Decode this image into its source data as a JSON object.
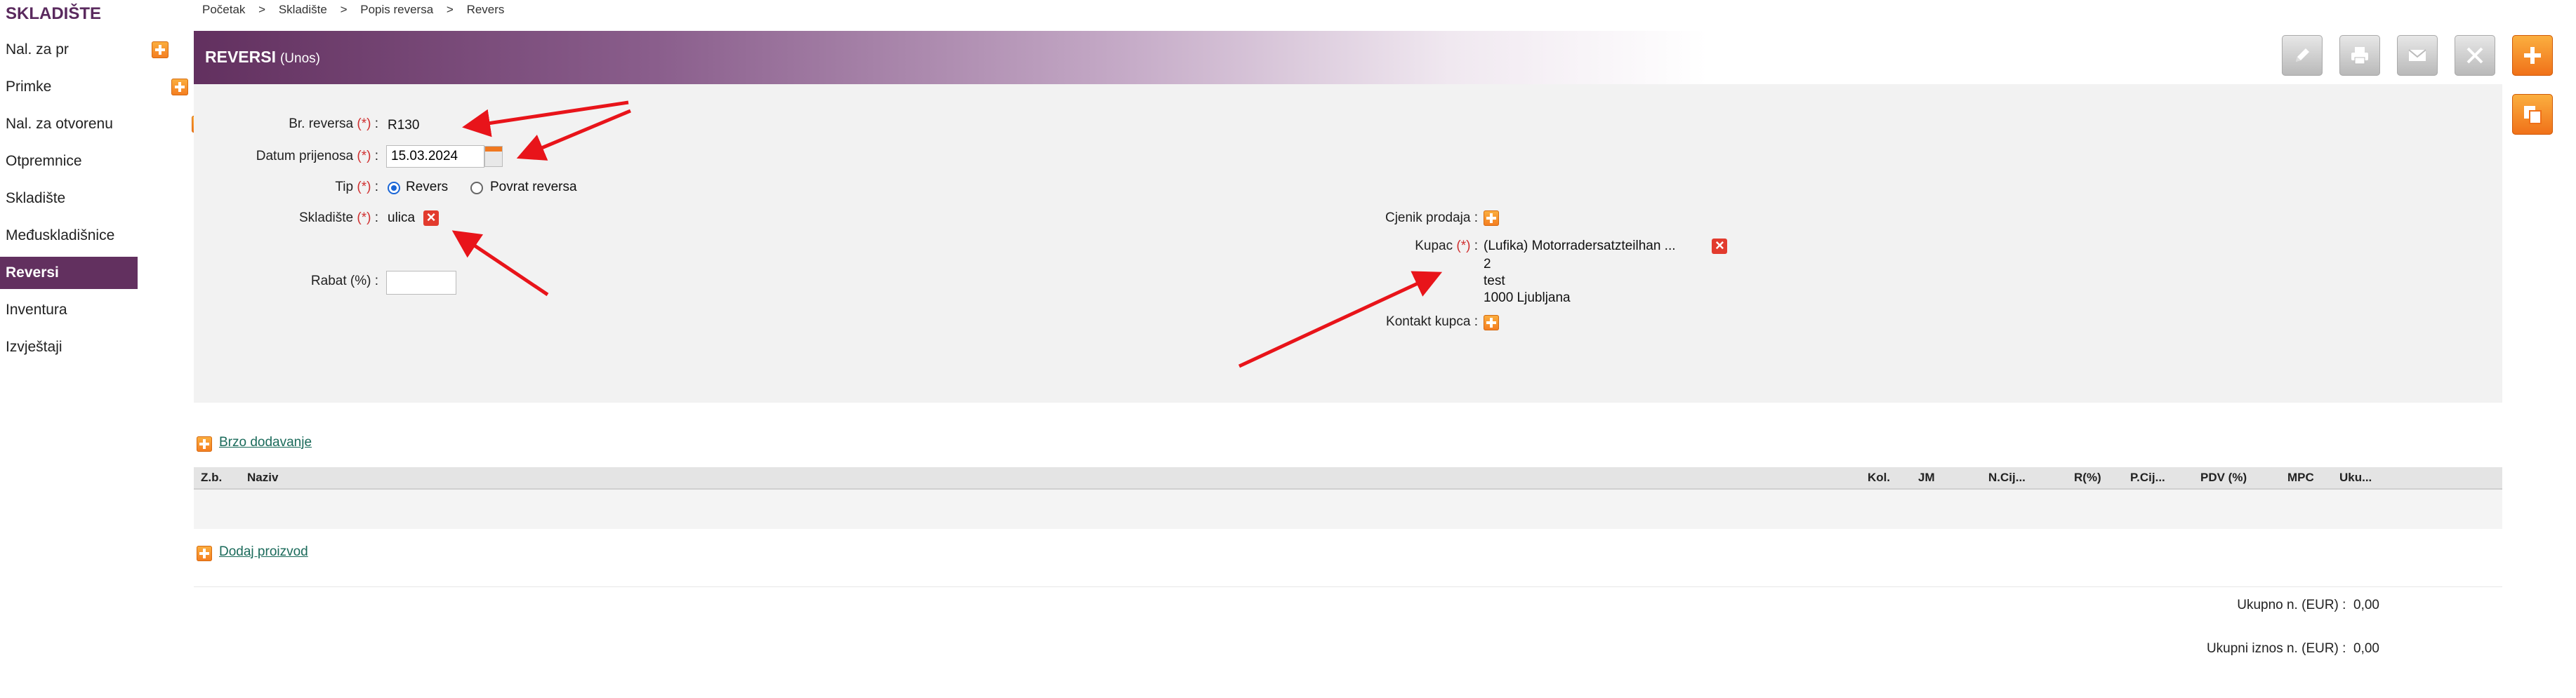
{
  "sidebar": {
    "title": "SKLADIŠTE",
    "items": [
      {
        "label": "Nal. za pr",
        "active": false
      },
      {
        "label": "Primke",
        "active": false
      },
      {
        "label": "Nal. za otvorenu",
        "active": false
      },
      {
        "label": "Otpremnice",
        "active": false
      },
      {
        "label": "Skladište",
        "active": false
      },
      {
        "label": "Međuskladišnice",
        "active": false
      },
      {
        "label": "Reversi",
        "active": true
      },
      {
        "label": "Inventura",
        "active": false
      },
      {
        "label": "Izvještaji",
        "active": false
      }
    ]
  },
  "breadcrumb": [
    "Početak",
    ">",
    "Skladište",
    ">",
    "Popis reversa",
    ">",
    "Revers"
  ],
  "header": {
    "title": "REVERSI",
    "subtitle": "(Unos)"
  },
  "toolbar": {
    "edit_icon": "pencil-icon",
    "print_icon": "printer-icon",
    "email_icon": "envelope-icon",
    "cancel_icon": "close-icon",
    "add_icon": "plus-icon",
    "copy_icon": "copy-icon"
  },
  "form": {
    "br_reversa": {
      "label": "Br. reversa",
      "required": "(*)",
      "value": "R130"
    },
    "datum": {
      "label": "Datum prijenosa",
      "required": "(*)",
      "value": "15.03.2024"
    },
    "tip": {
      "label": "Tip",
      "required": "(*)",
      "options": [
        "Revers",
        "Povrat reversa"
      ],
      "selected": "Revers"
    },
    "skladiste": {
      "label": "Skladište",
      "required": "(*)",
      "value": "ulica"
    },
    "rabat": {
      "label": "Rabat (%)",
      "value": ""
    },
    "cjenik": {
      "label": "Cjenik prodaja"
    },
    "kupac": {
      "label": "Kupac",
      "required": "(*)",
      "name": "(Lufika) Motorradersatzteilhan ...",
      "line1": "2",
      "line2": "test",
      "line3": "1000 Ljubljana"
    },
    "kontakt": {
      "label": "Kontakt kupca"
    },
    "colon": ":"
  },
  "links": {
    "quick_add": "Brzo dodavanje",
    "add_product": "Dodaj proizvod"
  },
  "table": {
    "columns": [
      "Z.b.",
      "Naziv",
      "Kol.",
      "JM",
      "N.Cij...",
      "R(%)",
      "P.Cij...",
      "PDV (%)",
      "MPC",
      "Uku..."
    ]
  },
  "totals": {
    "net_label": "Ukupno n. (EUR) :",
    "net_value": "0,00",
    "total_label": "Ukupni iznos n. (EUR) :",
    "total_value": "0,00"
  },
  "colors": {
    "brand": "#62305f",
    "accent": "#f07820",
    "annotation_arrow": "#e8141a"
  }
}
